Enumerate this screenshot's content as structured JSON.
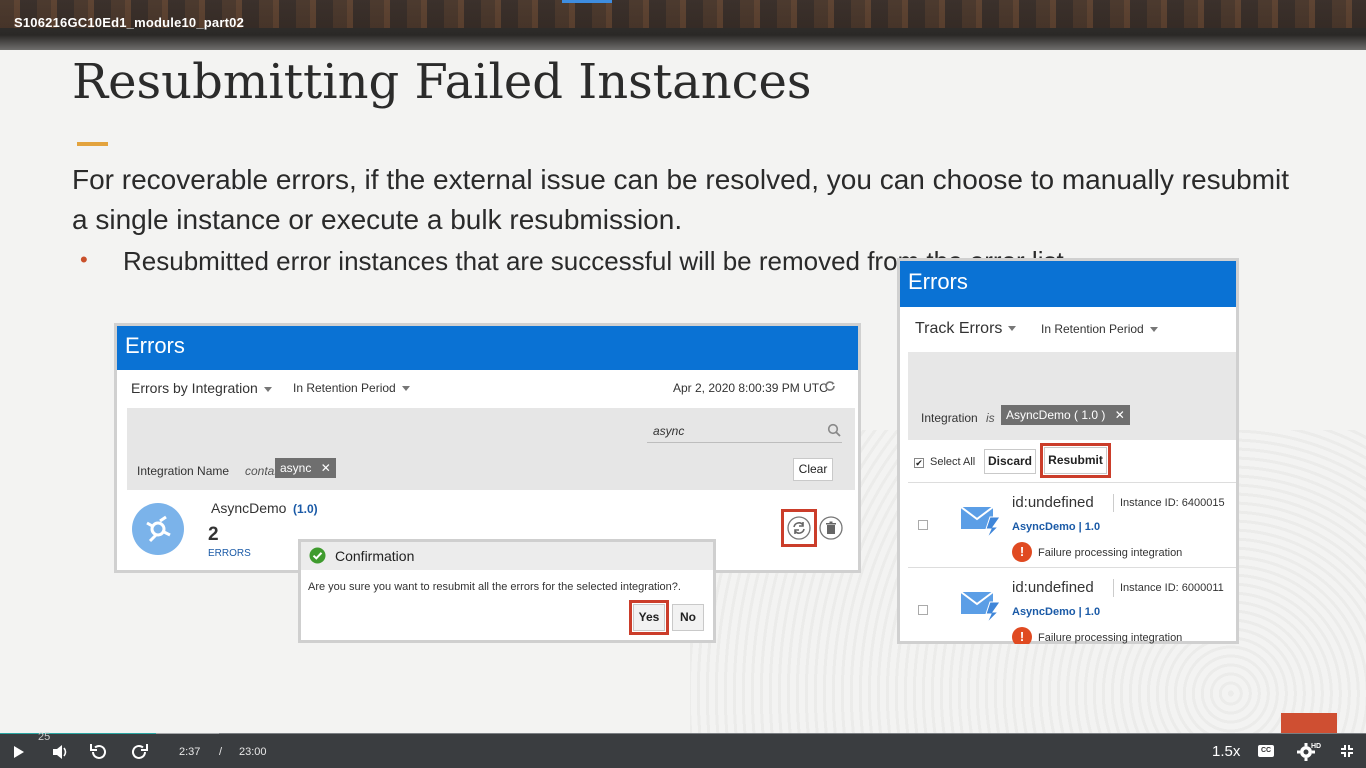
{
  "video": {
    "title": "S106216GC10Ed1_module10_part02"
  },
  "slide": {
    "title": "Resubmitting Failed Instances",
    "lead": "For recoverable errors, if the external issue can be resolved, you can choose to manually resubmit a single instance or execute a bulk resubmission.",
    "bullet_marker": "•",
    "bullet": "Resubmitted error instances that are successful will be removed from the error list.",
    "accent_color": "#e3a33e"
  },
  "left_panel": {
    "header": "Errors",
    "view_selector": "Errors by Integration",
    "period_selector": "In Retention Period",
    "timestamp": "Apr 2, 2020 8:00:39 PM UTC",
    "search_value": "async",
    "filter_field": "Integration Name",
    "filter_op": "contains",
    "filter_value": "async",
    "clear_label": "Clear",
    "integration_name": "AsyncDemo",
    "integration_version": "(1.0)",
    "error_count": "2",
    "errors_label": "ERRORS"
  },
  "dialog": {
    "title": "Confirmation",
    "message": "Are you sure you want to resubmit all the errors for the selected integration?.",
    "yes_label": "Yes",
    "no_label": "No"
  },
  "right_panel": {
    "header": "Errors",
    "view_selector": "Track Errors",
    "period_selector": "In Retention Period",
    "filter_field": "Integration",
    "filter_op": "is",
    "filter_value": "AsyncDemo ( 1.0 )",
    "select_all_label": "Select All",
    "discard_label": "Discard",
    "resubmit_label": "Resubmit",
    "rows": [
      {
        "id": "id:undefined",
        "instance": "Instance ID: 6400015",
        "link": "AsyncDemo | 1.0",
        "error": "Failure processing integration"
      },
      {
        "id": "id:undefined",
        "instance": "Instance ID: 6000011",
        "link": "AsyncDemo | 1.0",
        "error": "Failure processing integration"
      }
    ]
  },
  "player": {
    "current_time": "2:37",
    "separator": "/",
    "duration": "23:00",
    "speed": "1.5x",
    "slide_number": "25",
    "hd_badge": "HD",
    "progress": 0.114,
    "buffered": 0.16,
    "progress_color": "#2aa6a3"
  }
}
